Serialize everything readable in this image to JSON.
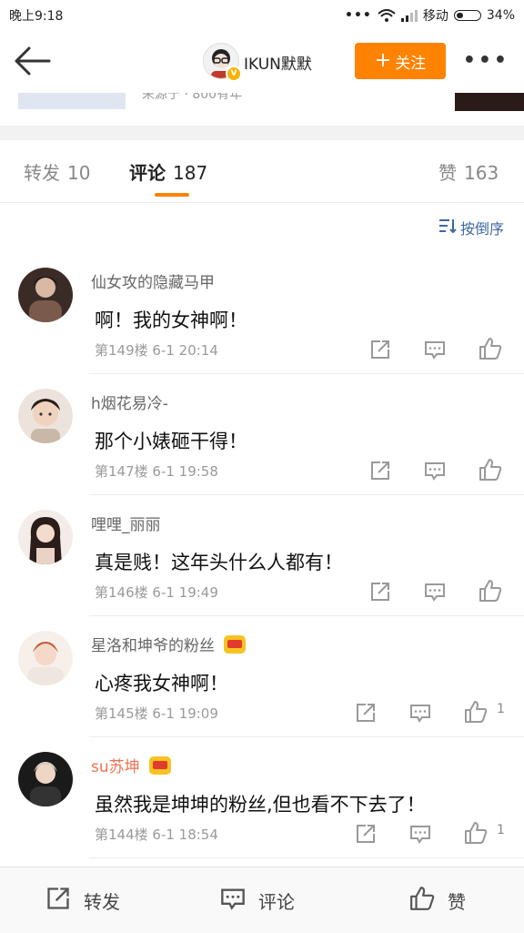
{
  "status_bar": {
    "time": "晚上9:18",
    "carrier": "移动",
    "battery": "34%",
    "battery_level": 0.34
  },
  "header": {
    "back_icon": "arrow-left-icon",
    "name": "IKUN默默",
    "follow_label": "关注",
    "more_icon": "more-dots-icon"
  },
  "post_strip": {
    "partial_text": "来源于 · 800有年"
  },
  "tabs": [
    {
      "label": "转发",
      "count": "10"
    },
    {
      "label": "评论",
      "count": "187"
    },
    {
      "label": "赞",
      "count": "163"
    }
  ],
  "sort": {
    "label": "按倒序"
  },
  "comments": [
    {
      "username": "仙女攻的隐藏马甲",
      "vip": false,
      "text": "啊！我的女神啊！",
      "meta": "第149楼 6-1 20:14",
      "likes": ""
    },
    {
      "username": "h烟花易冷-",
      "vip": false,
      "text": "那个小婊砸干得！",
      "meta": "第147楼 6-1 19:58",
      "likes": ""
    },
    {
      "username": "哩哩_丽丽",
      "vip": false,
      "text": "真是贱！这年头什么人都有！",
      "meta": "第146楼 6-1 19:49",
      "likes": ""
    },
    {
      "username": "星洛和坤爷的粉丝",
      "vip": true,
      "text": "心疼我女神啊！",
      "meta": "第145楼 6-1 19:09",
      "likes": "1"
    },
    {
      "username": "su苏坤",
      "vip": true,
      "text": "虽然我是坤坤的粉丝,但也看不下去了！",
      "meta": "第144楼 6-1 18:54",
      "likes": "1"
    }
  ],
  "bottom_bar": {
    "repost": "转发",
    "comment": "评论",
    "like": "赞"
  },
  "colors": {
    "accent": "#ff8200",
    "link": "#3b6aa0",
    "vip_name": "#eb7350"
  }
}
